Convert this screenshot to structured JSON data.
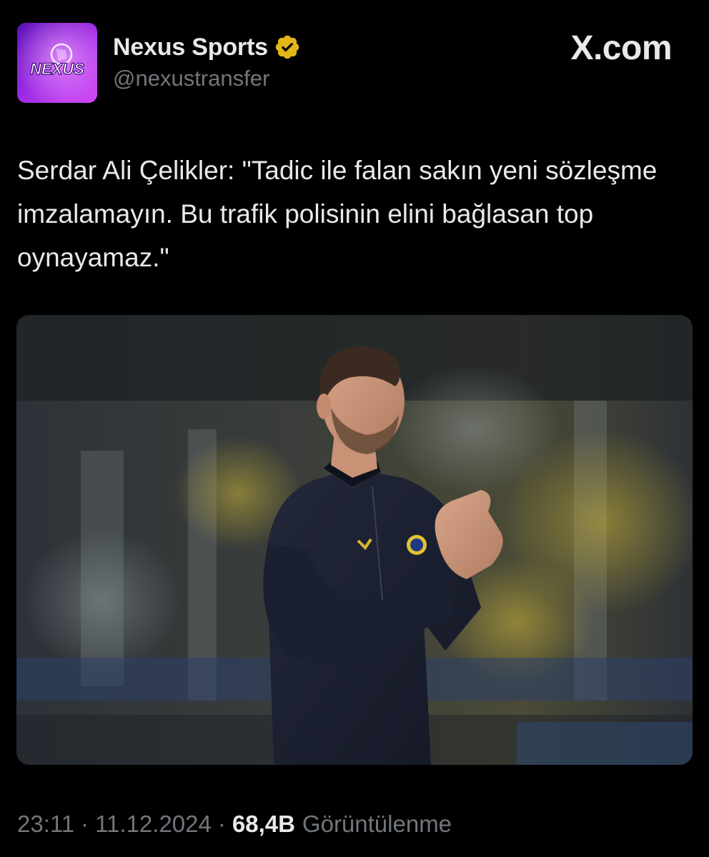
{
  "author": {
    "display_name": "Nexus Sports",
    "handle": "@nexustransfer",
    "verified": true,
    "avatar_logo_text": "NEXUS",
    "avatar_colors": [
      "#7a1fd6",
      "#c13cf0"
    ]
  },
  "brand": {
    "site": "X.com"
  },
  "tweet": {
    "text": "Serdar Ali Çelikler: \"Tadic ile falan sakın yeni sözleşme imzalamayın. Bu trafik polisinin elini bağlasan top oynayamaz.\""
  },
  "meta": {
    "time": "23:11",
    "date": "11.12.2024",
    "separator": "·",
    "views_count": "68,4B",
    "views_label": "Görüntülenme"
  },
  "colors": {
    "background": "#000000",
    "text_primary": "#e7e9ea",
    "text_secondary": "#71767b",
    "verified_badge": "#e2b719"
  },
  "icons": {
    "verified": "verified-badge-icon",
    "brand": "x-logo"
  }
}
